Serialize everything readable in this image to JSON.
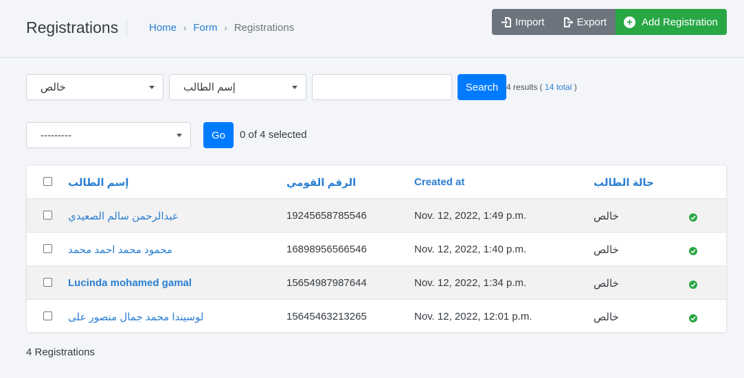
{
  "header": {
    "title": "Registrations",
    "breadcrumb": [
      "Home",
      "Form",
      "Registrations"
    ],
    "import_label": "Import",
    "export_label": "Export",
    "add_label": "Add Registration"
  },
  "filters": {
    "status_value": "خالص",
    "field_value": "إسم الطالب",
    "search_value": "",
    "search_label": "Search",
    "results_prefix": "4 results (",
    "total_link": "14 total",
    "results_suffix": ")"
  },
  "bulk": {
    "action_value": "---------",
    "go_label": "Go",
    "selected_text": "0 of 4 selected"
  },
  "table": {
    "columns": [
      "إسم الطالب",
      "الرقم القومي",
      "Created at",
      "حالة الطالب"
    ],
    "rows": [
      {
        "name": "عبدالرحمن سالم الصعيدي",
        "national_id": "19245658785546",
        "created": "Nov. 12, 2022, 1:49 p.m.",
        "status": "خالص",
        "paid": true
      },
      {
        "name": "محمود محمد احمد محمد",
        "national_id": "16898956566546",
        "created": "Nov. 12, 2022, 1:40 p.m.",
        "status": "خالص",
        "paid": true
      },
      {
        "name": "Lucinda mohamed gamal",
        "national_id": "15654987987644",
        "created": "Nov. 12, 2022, 1:34 p.m.",
        "status": "خالص",
        "paid": true
      },
      {
        "name": "لوسيندا محمد جمال منصور على",
        "national_id": "15645463213265",
        "created": "Nov. 12, 2022, 12:01 p.m.",
        "status": "خالص",
        "paid": true
      }
    ]
  },
  "footer": {
    "count_text": "4 Registrations"
  },
  "colors": {
    "primary": "#007bff",
    "link": "#2a7ed2",
    "success": "#28a745",
    "secondary": "#6c757d"
  }
}
